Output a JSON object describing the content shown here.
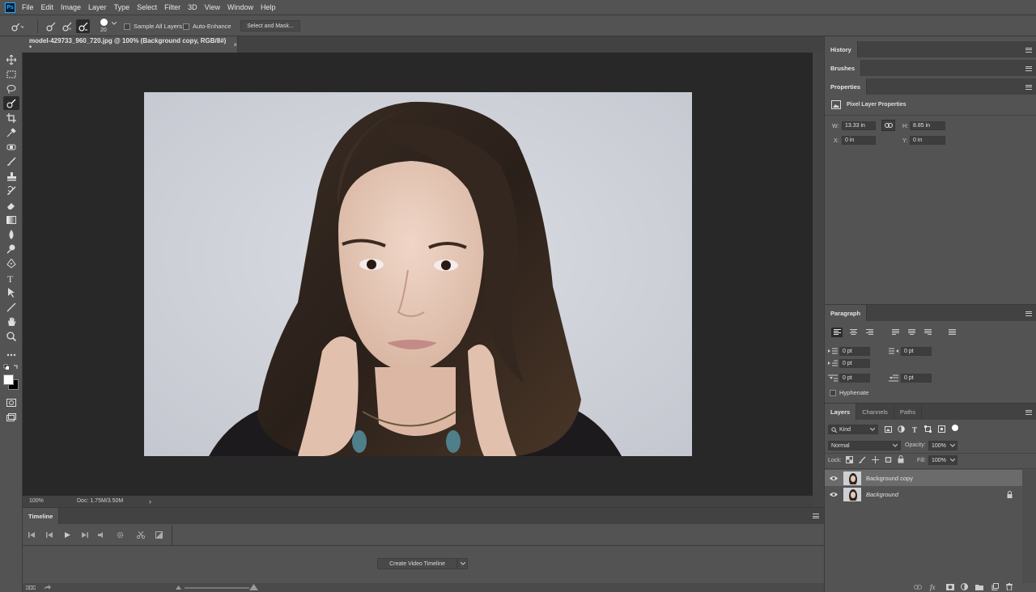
{
  "app": {
    "logo": "Ps"
  },
  "menu": [
    "File",
    "Edit",
    "Image",
    "Layer",
    "Type",
    "Select",
    "Filter",
    "3D",
    "View",
    "Window",
    "Help"
  ],
  "options": {
    "brush_size": "20",
    "sample_all_layers": "Sample All Layers",
    "auto_enhance": "Auto-Enhance",
    "select_mask": "Select and Mask..."
  },
  "document": {
    "tab_title": "model-429733_960_720.jpg @ 100% (Background copy, RGB/8#) *",
    "close": "×",
    "zoom": "100%",
    "doc_info": "Doc: 1.75M/3.50M",
    "status_arrow": "›"
  },
  "timeline": {
    "title": "Timeline",
    "create_button": "Create Video Timeline"
  },
  "dock": {
    "history": "History",
    "brushes": "Brushes",
    "properties": {
      "title": "Properties",
      "subtitle": "Pixel Layer Properties",
      "w_label": "W:",
      "w_value": "13.33 in",
      "h_label": "H:",
      "h_value": "8.85 in",
      "x_label": "X:",
      "x_value": "0 in",
      "y_label": "Y:",
      "y_value": "0 in"
    },
    "paragraph": {
      "title": "Paragraph",
      "indent_left": "0 pt",
      "indent_right": "0 pt",
      "first_line": "0 pt",
      "space_before": "0 pt",
      "space_after": "0 pt",
      "hyphenate": "Hyphenate"
    },
    "layers": {
      "tabs": [
        "Layers",
        "Channels",
        "Paths"
      ],
      "filter_kind": "Kind",
      "blend_mode": "Normal",
      "opacity_label": "Opacity:",
      "opacity_value": "100%",
      "lock_label": "Lock:",
      "fill_label": "Fill:",
      "fill_value": "100%",
      "items": [
        {
          "name": "Background copy",
          "selected": true
        },
        {
          "name": "Background",
          "locked": true
        }
      ]
    }
  },
  "colors": {
    "ui_bg": "#535353",
    "canvas_bg": "#282828",
    "panel_head": "#424242",
    "photo_bg": "#cdd0d6",
    "hair": "#2e241e"
  }
}
